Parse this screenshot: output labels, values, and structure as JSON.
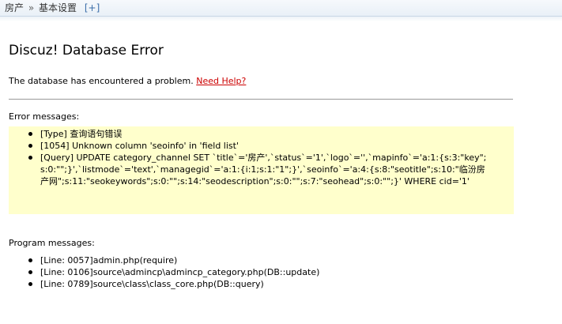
{
  "breadcrumb": {
    "root": "房产",
    "separator": "»",
    "current": "基本设置",
    "add_label": "[+]"
  },
  "page": {
    "title": "Discuz! Database Error",
    "intro_text": "The database has encountered a problem.",
    "help_link": "Need Help?"
  },
  "error_messages": {
    "heading": "Error messages:",
    "items": [
      "[Type] 查询语句错误",
      "[1054] Unknown column 'seoinfo' in 'field list'",
      "[Query] UPDATE category_channel SET `title`='房产',`status`='1',`logo`='',`mapinfo`='a:1:{s:3:\"key\";s:0:\"\";}',`listmode`='text',`managegid`='a:1:{i:1;s:1:\"1\";}',`seoinfo`='a:4:{s:8:\"seotitle\";s:10:\"临汾房产网\";s:11:\"seokeywords\";s:0:\"\";s:14:\"seodescription\";s:0:\"\";s:7:\"seohead\";s:0:\"\";}' WHERE cid='1'"
    ]
  },
  "program_messages": {
    "heading": "Program messages:",
    "items": [
      "[Line: 0057]admin.php(require)",
      "[Line: 0106]source\\admincp\\admincp_category.php(DB::update)",
      "[Line: 0789]source\\class\\class_core.php(DB::query)"
    ]
  },
  "colors": {
    "error_box_bg": "#ffffcc",
    "link": "#cc0000",
    "topbar_border": "#c9d7e6"
  }
}
